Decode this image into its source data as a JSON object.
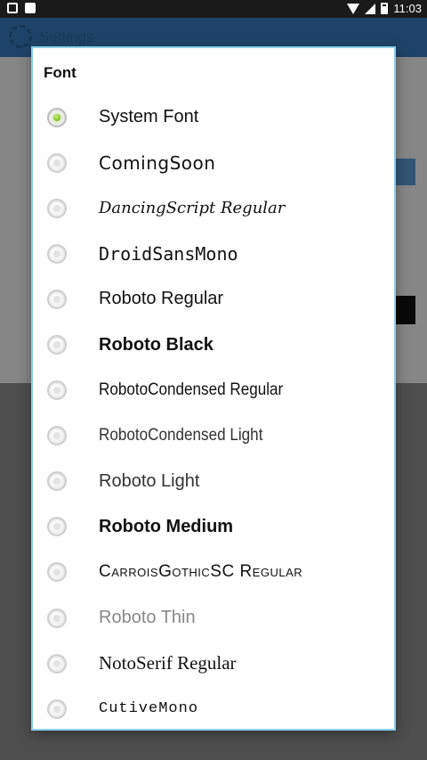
{
  "status_bar": {
    "time": "11:03",
    "icons": [
      "image-icon",
      "a-icon",
      "wifi-icon",
      "signal-icon",
      "battery-icon"
    ]
  },
  "app_bar": {
    "title": "Settings"
  },
  "dialog": {
    "title": "Font",
    "selected_index": 0,
    "accent_color": "#7dc21e",
    "options": [
      {
        "label": "System Font"
      },
      {
        "label": "ComingSoon"
      },
      {
        "label": "DancingScript Regular"
      },
      {
        "label": "DroidSansMono"
      },
      {
        "label": "Roboto Regular"
      },
      {
        "label": "Roboto Black"
      },
      {
        "label": "RobotoCondensed Regular"
      },
      {
        "label": "RobotoCondensed Light"
      },
      {
        "label": "Roboto Light"
      },
      {
        "label": "Roboto Medium"
      },
      {
        "label": "CarroisGothicSC Regular"
      },
      {
        "label": "Roboto Thin"
      },
      {
        "label": "NotoSerif Regular"
      },
      {
        "label": "CutiveMono"
      }
    ]
  }
}
